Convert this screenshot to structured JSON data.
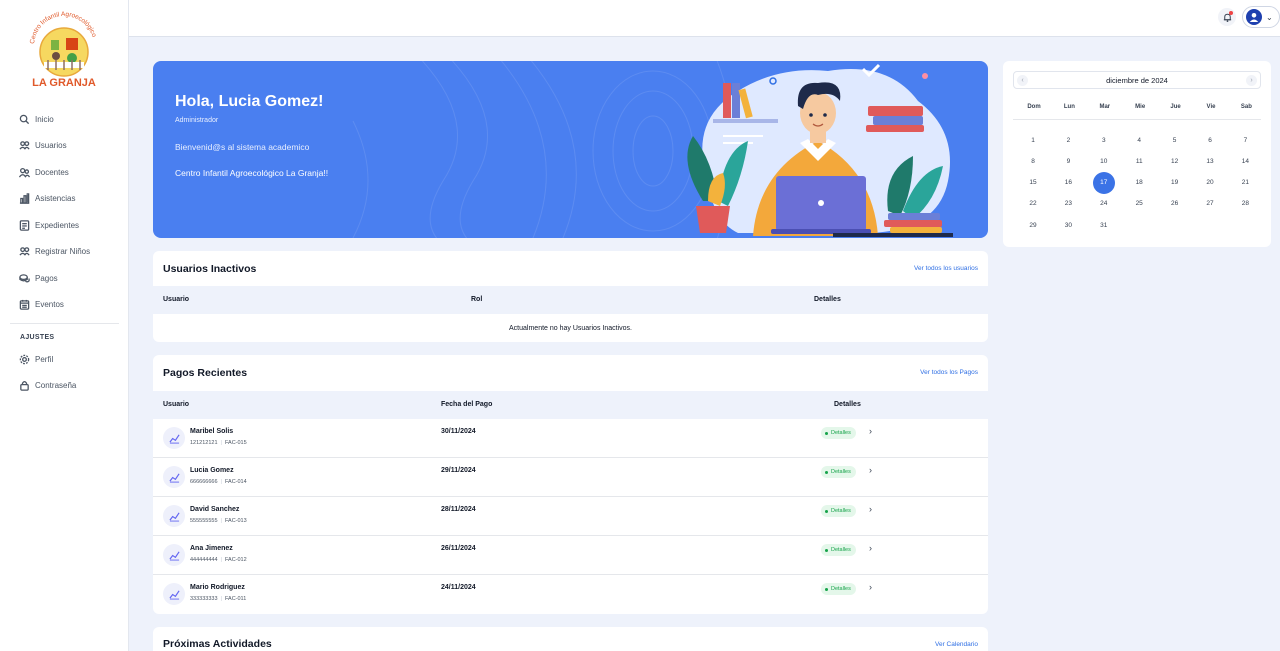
{
  "sidebar": {
    "logo": {
      "arc_text": "Centro Infantil Agroecológico",
      "name": "LA GRANJA"
    },
    "items": [
      {
        "label": "Inicio",
        "icon": "home-icon"
      },
      {
        "label": "Usuarios",
        "icon": "users-icon"
      },
      {
        "label": "Docentes",
        "icon": "teachers-icon"
      },
      {
        "label": "Asistencias",
        "icon": "bar-chart-icon"
      },
      {
        "label": "Expedientes",
        "icon": "folder-icon"
      },
      {
        "label": "Registrar Niños",
        "icon": "user-plus-icon"
      },
      {
        "label": "Pagos",
        "icon": "cash-icon"
      },
      {
        "label": "Eventos",
        "icon": "calendar-icon"
      }
    ],
    "settings_title": "AJUSTES",
    "settings_items": [
      {
        "label": "Perfil",
        "icon": "gear-icon"
      },
      {
        "label": "Contraseña",
        "icon": "lock-icon"
      }
    ]
  },
  "hero": {
    "greeting": "Hola, Lucia Gomez!",
    "role": "Administrador",
    "welcome": "Bienvenid@s al sistema academico",
    "center": "Centro Infantil Agroecológico La Granja!!"
  },
  "inactive_users": {
    "title": "Usuarios Inactivos",
    "link": "Ver todos los usuarios",
    "columns": [
      "Usuario",
      "Rol",
      "Detalles"
    ],
    "empty_message": "Actualmente no hay Usuarios Inactivos."
  },
  "payments": {
    "title": "Pagos Recientes",
    "link": "Ver todos los Pagos",
    "columns": [
      "Usuario",
      "Fecha del Pago",
      "Detalles"
    ],
    "badge_label": "Detalles",
    "rows": [
      {
        "name": "Maribel Solis",
        "id": "121212121",
        "invoice": "FAC-015",
        "date": "30/11/2024"
      },
      {
        "name": "Lucia Gomez",
        "id": "666666666",
        "invoice": "FAC-014",
        "date": "29/11/2024"
      },
      {
        "name": "David Sanchez",
        "id": "555555555",
        "invoice": "FAC-013",
        "date": "28/11/2024"
      },
      {
        "name": "Ana Jimenez",
        "id": "444444444",
        "invoice": "FAC-012",
        "date": "26/11/2024"
      },
      {
        "name": "Mario Rodriguez",
        "id": "333333333",
        "invoice": "FAC-011",
        "date": "24/11/2024"
      }
    ]
  },
  "activities": {
    "title": "Próximas Actividades",
    "link": "Ver Calendario"
  },
  "calendar": {
    "month_label": "diciembre de 2024",
    "weekdays": [
      "Dom",
      "Lun",
      "Mar",
      "Mie",
      "Jue",
      "Vie",
      "Sab"
    ],
    "first_weekday_index": 0,
    "days_in_month": 31,
    "selected_day": 17
  },
  "colors": {
    "accent": "#3b73e6",
    "hero_bg": "#4a7ff0",
    "badge_green": "#16a34a"
  }
}
